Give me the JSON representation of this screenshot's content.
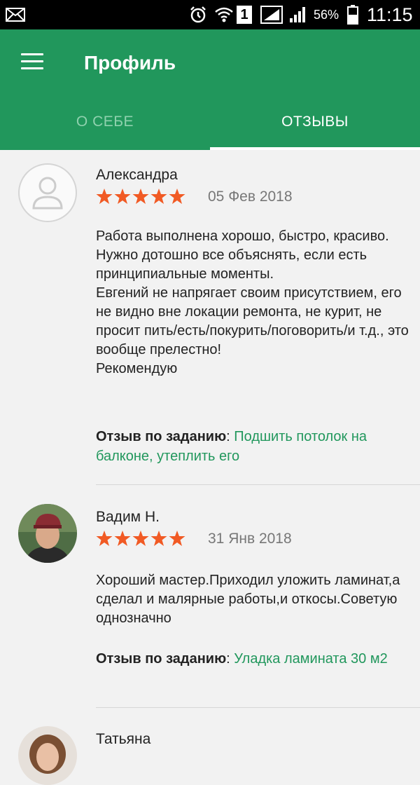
{
  "status_bar": {
    "battery": "56%",
    "time": "11:15",
    "sim_slot": "1",
    "icons": [
      "mail-icon",
      "alarm-icon",
      "wifi-icon",
      "sim1-icon",
      "signal-icon",
      "battery-icon"
    ]
  },
  "header": {
    "title": "Профиль",
    "menu_icon": "hamburger-menu-icon"
  },
  "tabs": [
    {
      "label": "О СЕБЕ",
      "active": false
    },
    {
      "label": "ОТЗЫВЫ",
      "active": true
    }
  ],
  "colors": {
    "brand_green": "#21975c",
    "star_orange": "#f15a24",
    "link_green": "#21975c"
  },
  "reviews": [
    {
      "name": "Александра",
      "rating": 5,
      "date": "05 Фев 2018",
      "avatar": "placeholder-person-icon",
      "text": "Работа выполнена хорошо, быстро, красиво. Нужно дотошно все объяснять, если есть принципиальные моменты.\n Евгений не напрягает своим присутствием, его не видно вне локации ремонта, не курит, не просит пить/есть/покурить/поговорить/и т.д., это вообще прелестно!\nРекомендую",
      "task_label": "Отзыв по заданию",
      "task_link": "Подшить потолок на балконе, утеплить его"
    },
    {
      "name": "Вадим Н.",
      "rating": 5,
      "date": "31 Янв 2018",
      "avatar": "user-photo",
      "text": "Хороший мастер.Приходил уложить ламинат,а сделал и малярные работы,и откосы.Советую однозначно",
      "task_label": "Отзыв по заданию",
      "task_link": "Уладка ламината 30 м2"
    },
    {
      "name": "Татьяна",
      "avatar": "user-photo"
    }
  ]
}
